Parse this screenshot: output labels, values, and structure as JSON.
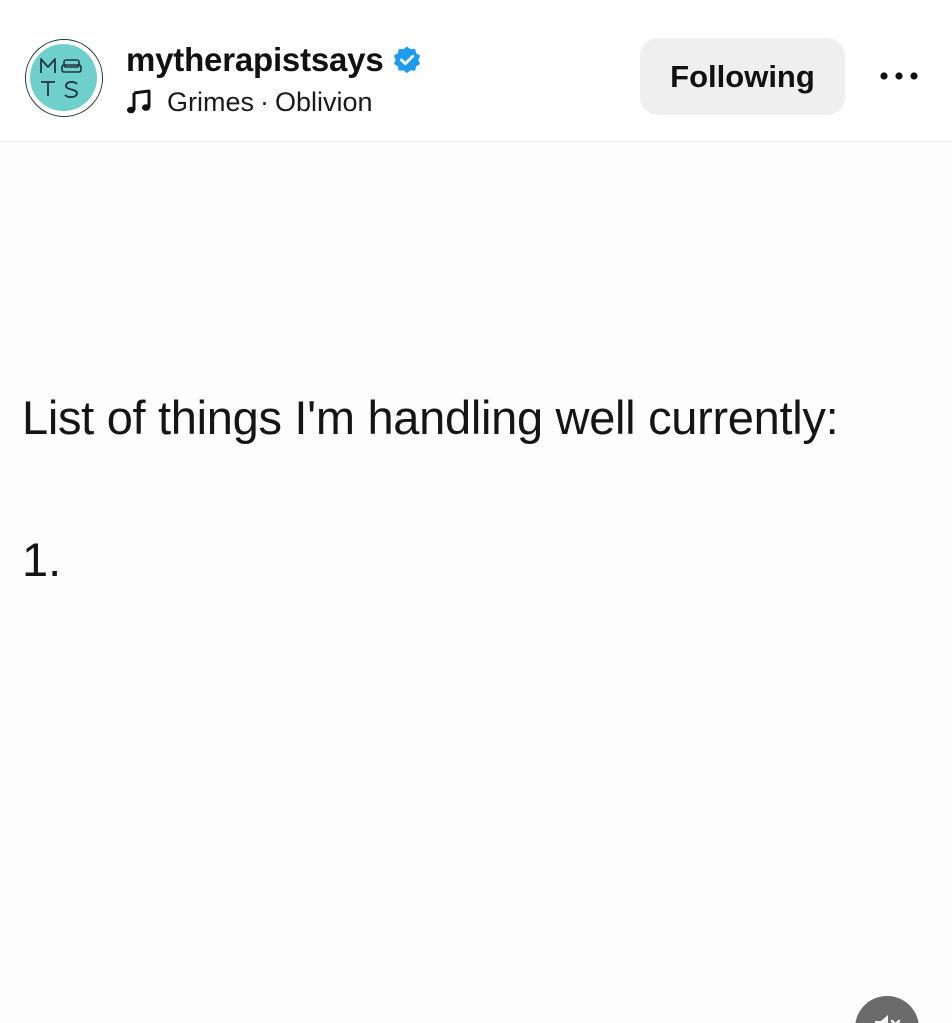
{
  "post": {
    "author": {
      "username": "mytherapistsays",
      "verified": true,
      "avatar_letters": [
        "M",
        "T",
        "S"
      ],
      "avatar_color": "#6fd0cb"
    },
    "audio": {
      "icon": "music-note-icon",
      "artist": "Grimes",
      "separator": "·",
      "track": "Oblivion"
    },
    "follow_label": "Following",
    "more_icon": "more-horizontal-icon",
    "content": {
      "heading": "List of things I'm handling well currently:",
      "list_number": "1."
    },
    "audio_toggle_icon": "speaker-muted-icon",
    "colors": {
      "verified_blue": "#1d9bf0",
      "button_bg": "#efefef",
      "text": "#111111"
    }
  }
}
